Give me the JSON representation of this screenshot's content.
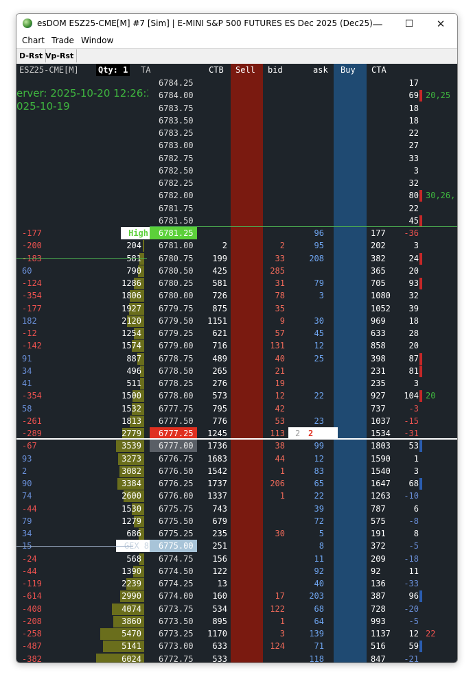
{
  "window": {
    "title": "esDOM ESZ25-CME[M] #7 [Sim]  | E-MINI S&P 500 FUTURES ES Dec 2025 (Dec25)",
    "minimize": "—",
    "maximize": "☐",
    "close": "✕"
  },
  "menu": [
    "Chart",
    "Trade",
    "Window"
  ],
  "toolbar": [
    "D-Rst",
    "Vp-Rst"
  ],
  "dom": {
    "symbol": "ESZ25-CME[M]",
    "qty": "Qty: 1",
    "ta": "TA",
    "server_line1": "erver: 2025-10-20  12:26:26",
    "server_line2": "025-10-19",
    "headers": {
      "ctb": "CTB",
      "sell": "Sell",
      "bid": "bid",
      "ask": "ask",
      "buy": "Buy",
      "cta": "CTA"
    },
    "rows": [
      {
        "price": "6784.25",
        "cta": "17"
      },
      {
        "price": "6784.00",
        "cta": "69",
        "extra": "20,25",
        "ctac": "neg"
      },
      {
        "price": "6783.75",
        "cta": "18"
      },
      {
        "price": "6783.50",
        "cta": "18"
      },
      {
        "price": "6783.25",
        "cta": "22"
      },
      {
        "price": "6783.00",
        "cta": "27"
      },
      {
        "price": "6782.75",
        "cta": "33"
      },
      {
        "price": "6782.50",
        "cta": "3"
      },
      {
        "price": "6782.25",
        "cta": "32"
      },
      {
        "price": "6782.00",
        "cta": "80",
        "extra": "30,26,",
        "ctac": "neg"
      },
      {
        "price": "6781.75",
        "cta": "22"
      },
      {
        "price": "6781.50",
        "cta": "45",
        "ctac": "neg"
      },
      {
        "left": "-177",
        "lc": "neg",
        "vol": "High",
        "price": "6781.25",
        "ask": "96",
        "ctb2": "177",
        "cta": "-36",
        "ctaclr": "neg",
        "hi": "high"
      },
      {
        "left": "-200",
        "lc": "neg",
        "vol": "204",
        "price": "6781.00",
        "ctb": "2",
        "bid": "2",
        "ask": "95",
        "ctb2": "202",
        "cta": "3"
      },
      {
        "left": "-183",
        "lc": "neg",
        "vol": "581",
        "price": "6780.75",
        "ctb": "199",
        "bid": "33",
        "ask": "208",
        "ctb2": "382",
        "cta": "24",
        "ctac": "neg"
      },
      {
        "left": "60",
        "lc": "pos",
        "vol": "790",
        "price": "6780.50",
        "ctb": "425",
        "bid": "285",
        "ctb2": "365",
        "cta": "20"
      },
      {
        "left": "-124",
        "lc": "neg",
        "vol": "1286",
        "price": "6780.25",
        "ctb": "581",
        "bid": "31",
        "ask": "79",
        "ctb2": "705",
        "cta": "93",
        "ctac": "neg"
      },
      {
        "left": "-354",
        "lc": "neg",
        "vol": "1806",
        "price": "6780.00",
        "ctb": "726",
        "bid": "78",
        "ask": "3",
        "ctb2": "1080",
        "cta": "32"
      },
      {
        "left": "-177",
        "lc": "neg",
        "vol": "1927",
        "price": "6779.75",
        "ctb": "875",
        "bid": "35",
        "ctb2": "1052",
        "cta": "39"
      },
      {
        "left": "182",
        "lc": "pos",
        "vol": "2120",
        "price": "6779.50",
        "ctb": "1151",
        "bid": "9",
        "ask": "30",
        "ctb2": "969",
        "cta": "18"
      },
      {
        "left": "-12",
        "lc": "neg",
        "vol": "1254",
        "price": "6779.25",
        "ctb": "621",
        "bid": "57",
        "ask": "45",
        "ctb2": "633",
        "cta": "28"
      },
      {
        "left": "-142",
        "lc": "neg",
        "vol": "1574",
        "price": "6779.00",
        "ctb": "716",
        "bid": "131",
        "ask": "12",
        "ctb2": "858",
        "cta": "20"
      },
      {
        "left": "91",
        "lc": "pos",
        "vol": "887",
        "price": "6778.75",
        "ctb": "489",
        "bid": "40",
        "ask": "25",
        "ctb2": "398",
        "cta": "87",
        "ctac": "neg"
      },
      {
        "left": "34",
        "lc": "pos",
        "vol": "496",
        "price": "6778.50",
        "ctb": "265",
        "bid": "21",
        "ctb2": "231",
        "cta": "81",
        "ctac": "neg"
      },
      {
        "left": "41",
        "lc": "pos",
        "vol": "511",
        "price": "6778.25",
        "ctb": "276",
        "bid": "19",
        "ctb2": "235",
        "cta": "3"
      },
      {
        "left": "-354",
        "lc": "neg",
        "vol": "1500",
        "price": "6778.00",
        "ctb": "573",
        "bid": "12",
        "ask": "22",
        "ctb2": "927",
        "cta": "104",
        "extra": "20",
        "ctac": "neg"
      },
      {
        "left": "58",
        "lc": "pos",
        "vol": "1532",
        "price": "6777.75",
        "ctb": "795",
        "bid": "42",
        "ctb2": "737",
        "cta": "-3",
        "ctaclr": "neg"
      },
      {
        "left": "-261",
        "lc": "neg",
        "vol": "1813",
        "price": "6777.50",
        "ctb": "776",
        "bid": "53",
        "ask": "23",
        "ctb2": "1037",
        "cta": "-15",
        "ctaclr": "neg"
      },
      {
        "left": "-289",
        "lc": "neg",
        "vol": "2779",
        "price": "6777.25",
        "ctb": "1245",
        "bid": "113",
        "bidx": "2",
        "ask": "2",
        "ctb2": "1534",
        "cta": "-31",
        "ctaclr": "neg",
        "hi": "last"
      },
      {
        "left": "-67",
        "lc": "neg",
        "vol": "3539",
        "price": "6777.00",
        "ctb": "1736",
        "bid": "38",
        "ask": "99",
        "ctb2": "1803",
        "cta": "53",
        "ctac": "pos",
        "hi": "cur"
      },
      {
        "left": "93",
        "lc": "pos",
        "vol": "3273",
        "price": "6776.75",
        "ctb": "1683",
        "bid": "44",
        "ask": "12",
        "ctb2": "1590",
        "cta": "1"
      },
      {
        "left": "2",
        "lc": "pos",
        "vol": "3082",
        "price": "6776.50",
        "ctb": "1542",
        "bid": "1",
        "ask": "83",
        "ctb2": "1540",
        "cta": "3"
      },
      {
        "left": "90",
        "lc": "pos",
        "vol": "3384",
        "price": "6776.25",
        "ctb": "1737",
        "bid": "206",
        "ask": "65",
        "ctb2": "1647",
        "cta": "68",
        "ctac": "pos"
      },
      {
        "left": "74",
        "lc": "pos",
        "vol": "2600",
        "price": "6776.00",
        "ctb": "1337",
        "bid": "1",
        "ask": "22",
        "ctb2": "1263",
        "cta": "-10",
        "ctaclr": "pos"
      },
      {
        "left": "-44",
        "lc": "neg",
        "vol": "1530",
        "price": "6775.75",
        "ctb": "743",
        "ask": "39",
        "ctb2": "787",
        "cta": "6"
      },
      {
        "left": "79",
        "lc": "pos",
        "vol": "1279",
        "price": "6775.50",
        "ctb": "679",
        "ask": "72",
        "ctb2": "575",
        "cta": "-8",
        "ctaclr": "pos"
      },
      {
        "left": "34",
        "lc": "pos",
        "vol": "686",
        "price": "6775.25",
        "ctb": "235",
        "bid": "30",
        "ask": "5",
        "ctb2": "191",
        "cta": "8"
      },
      {
        "left": "15",
        "lc": "pos",
        "vol": "GEX 8",
        "price": "6775.00",
        "ctb": "251",
        "ask": "8",
        "ctb2": "372",
        "cta": "-5",
        "ctaclr": "pos",
        "hi": "gex"
      },
      {
        "left": "-24",
        "lc": "neg",
        "vol": "568",
        "price": "6774.75",
        "ctb": "156",
        "ask": "11",
        "ctb2": "209",
        "cta": "-18",
        "ctaclr": "pos"
      },
      {
        "left": "-44",
        "lc": "neg",
        "vol": "1390",
        "price": "6774.50",
        "ctb": "122",
        "ask": "92",
        "ctb2": "92",
        "cta": "11"
      },
      {
        "left": "-119",
        "lc": "neg",
        "vol": "2239",
        "price": "6774.25",
        "ctb": "13",
        "ask": "40",
        "ctb2": "136",
        "cta": "-33",
        "ctaclr": "pos"
      },
      {
        "left": "-614",
        "lc": "neg",
        "vol": "2990",
        "price": "6774.00",
        "ctb": "160",
        "bid": "17",
        "ask": "203",
        "ctb2": "387",
        "cta": "96",
        "ctac": "pos"
      },
      {
        "left": "-408",
        "lc": "neg",
        "vol": "4074",
        "price": "6773.75",
        "ctb": "534",
        "bid": "122",
        "ask": "68",
        "ctb2": "728",
        "cta": "-20",
        "ctaclr": "pos"
      },
      {
        "left": "-208",
        "lc": "neg",
        "vol": "3860",
        "price": "6773.50",
        "ctb": "895",
        "bid": "1",
        "ask": "64",
        "ctb2": "993",
        "cta": "-5",
        "ctaclr": "pos"
      },
      {
        "left": "-258",
        "lc": "neg",
        "vol": "5470",
        "price": "6773.25",
        "ctb": "1170",
        "bid": "3",
        "ask": "139",
        "ctb2": "1137",
        "cta": "12",
        "extra": "22",
        "extraclr": "neg"
      },
      {
        "left": "-487",
        "lc": "neg",
        "vol": "5141",
        "price": "6773.00",
        "ctb": "633",
        "bid": "124",
        "ask": "71",
        "ctb2": "516",
        "cta": "59",
        "ctac": "pos"
      },
      {
        "left": "-382",
        "lc": "neg",
        "vol": "6024",
        "price": "6772.75",
        "ctb": "533",
        "ask": "118",
        "ctb2": "847",
        "cta": "-21",
        "ctaclr": "pos"
      }
    ]
  },
  "colors": {
    "background": "#1e242a",
    "sell_col": "#7a1a10",
    "buy_col": "#1f4a72",
    "volume_bar": "#6a6e1c",
    "high_label": "#5cd03a",
    "last_price": "#e03020",
    "negative": "#ef5350",
    "positive": "#6a8fd8"
  }
}
